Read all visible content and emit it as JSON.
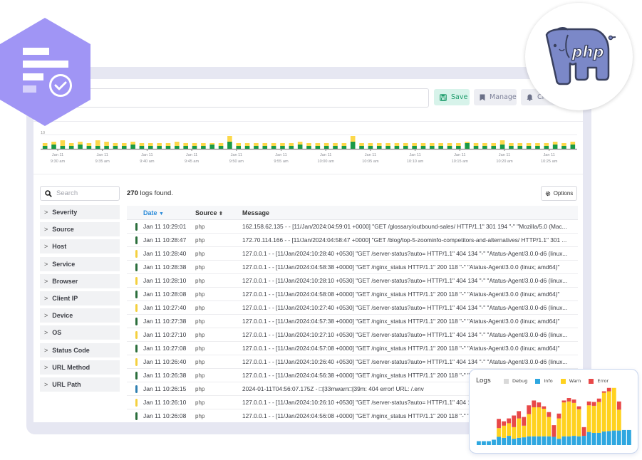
{
  "toolbar": {
    "query_placeholder": "",
    "save_label": "Save",
    "manage_label": "Manage",
    "create_label": "Cre"
  },
  "colors": {
    "accent": "#2a8bd9",
    "brand_hex": "#a095f5",
    "save_green": "#1f9d6c",
    "severity_info": "#2b6e3c",
    "severity_warn": "#f4d03f",
    "severity_debug": "#2f7fb0",
    "hist_info": "#1a9a46",
    "hist_warn": "#fcd84a"
  },
  "histogram": {
    "y_tick": "10",
    "x_labels": [
      [
        "Jan 11",
        "9:30 am"
      ],
      [
        "Jan 11",
        "9:35 am"
      ],
      [
        "Jan 11",
        "9:40 am"
      ],
      [
        "Jan 11",
        "9:45 am"
      ],
      [
        "Jan 11",
        "9:50 am"
      ],
      [
        "Jan 11",
        "9:55 am"
      ],
      [
        "Jan 11",
        "10:00 am"
      ],
      [
        "Jan 11",
        "10:05 am"
      ],
      [
        "Jan 11",
        "10:10 am"
      ],
      [
        "Jan 11",
        "10:15 am"
      ],
      [
        "Jan 11",
        "10:20 am"
      ],
      [
        "Jan 11",
        "10:25 am"
      ]
    ]
  },
  "chart_data": [
    {
      "type": "bar",
      "title": "",
      "stacked": true,
      "xlabel": "",
      "ylabel": "",
      "ylim": [
        0,
        12
      ],
      "y_ticks": [
        "10"
      ],
      "categories_note": "one bar per 30s interval from 9:28 am to 10:29 am, Jan 11",
      "tick_labels": [
        "Jan 11 9:30 am",
        "Jan 11 9:35 am",
        "Jan 11 9:40 am",
        "Jan 11 9:45 am",
        "Jan 11 9:50 am",
        "Jan 11 9:55 am",
        "Jan 11 10:00 am",
        "Jan 11 10:05 am",
        "Jan 11 10:10 am",
        "Jan 11 10:15 am",
        "Jan 11 10:20 am",
        "Jan 11 10:25 am"
      ],
      "series": [
        {
          "name": "Info",
          "color": "#1a9a46",
          "values": [
            2,
            3,
            2,
            2,
            3,
            2,
            2,
            2,
            2,
            2,
            3,
            2,
            2,
            2,
            2,
            2,
            2,
            2,
            2,
            3,
            2,
            5,
            2,
            2,
            2,
            2,
            2,
            2,
            2,
            3,
            2,
            2,
            2,
            2,
            2,
            5,
            2,
            2,
            2,
            2,
            2,
            2,
            2,
            2,
            2,
            2,
            2,
            2,
            4,
            2,
            2,
            2,
            3,
            2,
            2,
            2,
            2,
            2,
            3,
            2,
            3
          ]
        },
        {
          "name": "Warn",
          "color": "#fcd84a",
          "values": [
            2,
            2,
            4,
            2,
            2,
            2,
            4,
            3,
            2,
            2,
            2,
            2,
            2,
            2,
            2,
            3,
            2,
            2,
            2,
            1,
            2,
            4,
            2,
            2,
            2,
            2,
            2,
            2,
            2,
            2,
            2,
            2,
            2,
            2,
            2,
            4,
            2,
            2,
            2,
            2,
            2,
            2,
            2,
            2,
            2,
            2,
            2,
            2,
            1,
            2,
            2,
            2,
            3,
            2,
            2,
            2,
            2,
            2,
            2,
            2,
            2
          ]
        }
      ]
    },
    {
      "type": "bar",
      "title": "Logs",
      "stacked": true,
      "legend": "top",
      "ylim": [
        0,
        100
      ],
      "series": [
        {
          "name": "Debug",
          "color": "#d9d9d9",
          "values": [
            0,
            0,
            0,
            0,
            0,
            0,
            0,
            0,
            0,
            0,
            0,
            0,
            0,
            0,
            0,
            0,
            0,
            0,
            0,
            0,
            0,
            0,
            0,
            0,
            0,
            0,
            0,
            0,
            0,
            0,
            0
          ]
        },
        {
          "name": "Info",
          "color": "#2ea7e0",
          "values": [
            8,
            8,
            8,
            11,
            17,
            15,
            19,
            13,
            15,
            16,
            18,
            18,
            18,
            18,
            18,
            17,
            13,
            18,
            18,
            19,
            18,
            19,
            27,
            25,
            25,
            28,
            29,
            30,
            30,
            31,
            31
          ]
        },
        {
          "name": "Warn",
          "color": "#ffd21f",
          "values": [
            0,
            0,
            0,
            0,
            18,
            25,
            26,
            24,
            40,
            24,
            46,
            60,
            60,
            57,
            40,
            0,
            42,
            70,
            72,
            68,
            56,
            0,
            55,
            56,
            64,
            80,
            82,
            88,
            43,
            0,
            0
          ]
        },
        {
          "name": "Error",
          "color": "#e84848",
          "values": [
            0,
            0,
            0,
            0,
            19,
            9,
            10,
            24,
            15,
            18,
            18,
            14,
            10,
            5,
            10,
            24,
            10,
            4,
            7,
            7,
            6,
            18,
            8,
            8,
            7,
            3,
            7,
            0,
            17,
            0,
            0
          ]
        }
      ]
    }
  ],
  "sidebar": {
    "search_placeholder": "Search",
    "facets": [
      "Severity",
      "Source",
      "Host",
      "Service",
      "Browser",
      "Client IP",
      "Device",
      "OS",
      "Status Code",
      "URL Method",
      "URL Path"
    ]
  },
  "results": {
    "count": "270",
    "count_suffix": " logs found.",
    "options_label": "Options"
  },
  "table": {
    "columns": [
      "Date",
      "Source",
      "Message"
    ],
    "rows": [
      {
        "sev": "info",
        "date": "Jan 11 10:29:01",
        "source": "php",
        "message": "162.158.62.135 - - [11/Jan/2024:04:59:01 +0000] \"GET /glossary/outbound-sales/ HTTP/1.1\" 301 194 \"-\" \"Mozilla/5.0 (Mac..."
      },
      {
        "sev": "info",
        "date": "Jan 11 10:28:47",
        "source": "php",
        "message": "172.70.114.166 - - [11/Jan/2024:04:58:47 +0000] \"GET /blog/top-5-zoominfo-competitors-and-alternatives/ HTTP/1.1\" 301 ..."
      },
      {
        "sev": "warn",
        "date": "Jan 11 10:28:40",
        "source": "php",
        "message": "127.0.0.1 - - [11/Jan/2024:10:28:40 +0530] \"GET /server-status?auto= HTTP/1.1\" 404 134 \"-\" \"Atatus-Agent/3.0.0-d6 (linux..."
      },
      {
        "sev": "info",
        "date": "Jan 11 10:28:38",
        "source": "php",
        "message": "127.0.0.1 - - [11/Jan/2024:04:58:38 +0000] \"GET /nginx_status HTTP/1.1\" 200 118 \"-\" \"Atatus-Agent/3.0.0 (linux; amd64)\""
      },
      {
        "sev": "warn",
        "date": "Jan 11 10:28:10",
        "source": "php",
        "message": "127.0.0.1 - - [11/Jan/2024:10:28:10 +0530] \"GET /server-status?auto= HTTP/1.1\" 404 134 \"-\" \"Atatus-Agent/3.0.0-d6 (linux..."
      },
      {
        "sev": "info",
        "date": "Jan 11 10:28:08",
        "source": "php",
        "message": "127.0.0.1 - - [11/Jan/2024:04:58:08 +0000] \"GET /nginx_status HTTP/1.1\" 200 118 \"-\" \"Atatus-Agent/3.0.0 (linux; amd64)\""
      },
      {
        "sev": "warn",
        "date": "Jan 11 10:27:40",
        "source": "php",
        "message": "127.0.0.1 - - [11/Jan/2024:10:27:40 +0530] \"GET /server-status?auto= HTTP/1.1\" 404 134 \"-\" \"Atatus-Agent/3.0.0-d6 (linux..."
      },
      {
        "sev": "info",
        "date": "Jan 11 10:27:38",
        "source": "php",
        "message": "127.0.0.1 - - [11/Jan/2024:04:57:38 +0000] \"GET /nginx_status HTTP/1.1\" 200 118 \"-\" \"Atatus-Agent/3.0.0 (linux; amd64)\""
      },
      {
        "sev": "warn",
        "date": "Jan 11 10:27:10",
        "source": "php",
        "message": "127.0.0.1 - - [11/Jan/2024:10:27:10 +0530] \"GET /server-status?auto= HTTP/1.1\" 404 134 \"-\" \"Atatus-Agent/3.0.0-d6 (linux..."
      },
      {
        "sev": "info",
        "date": "Jan 11 10:27:08",
        "source": "php",
        "message": "127.0.0.1 - - [11/Jan/2024:04:57:08 +0000] \"GET /nginx_status HTTP/1.1\" 200 118 \"-\" \"Atatus-Agent/3.0.0 (linux; amd64)\""
      },
      {
        "sev": "warn",
        "date": "Jan 11 10:26:40",
        "source": "php",
        "message": "127.0.0.1 - - [11/Jan/2024:10:26:40 +0530] \"GET /server-status?auto= HTTP/1.1\" 404 134 \"-\" \"Atatus-Agent/3.0.0-d6 (linux..."
      },
      {
        "sev": "info",
        "date": "Jan 11 10:26:38",
        "source": "php",
        "message": "127.0.0.1 - - [11/Jan/2024:04:56:38 +0000] \"GET /nginx_status HTTP/1.1\" 200 118 \"-\" \"Atatus-Agent/3.0.0 (linux; amd64)\""
      },
      {
        "sev": "debug",
        "date": "Jan 11 10:26:15",
        "source": "php",
        "message": "2024-01-11T04:56:07.175Z - □[33mwarn□[39m: 404 error! URL: /.env"
      },
      {
        "sev": "warn",
        "date": "Jan 11 10:26:10",
        "source": "php",
        "message": "127.0.0.1 - - [11/Jan/2024:10:26:10 +0530] \"GET /server-status?auto= HTTP/1.1\" 404 134 \"-\" \"Atatus-Agent/3.0.0-d6 (linux..."
      },
      {
        "sev": "info",
        "date": "Jan 11 10:26:08",
        "source": "php",
        "message": "127.0.0.1 - - [11/Jan/2024:04:56:08 +0000] \"GET /nginx_status HTTP/1.1\" 200 118 \"-\" \"Atatus-Agent/3.0.0 (linux; amd64)\""
      }
    ]
  },
  "php_logo": {
    "text": "php"
  }
}
